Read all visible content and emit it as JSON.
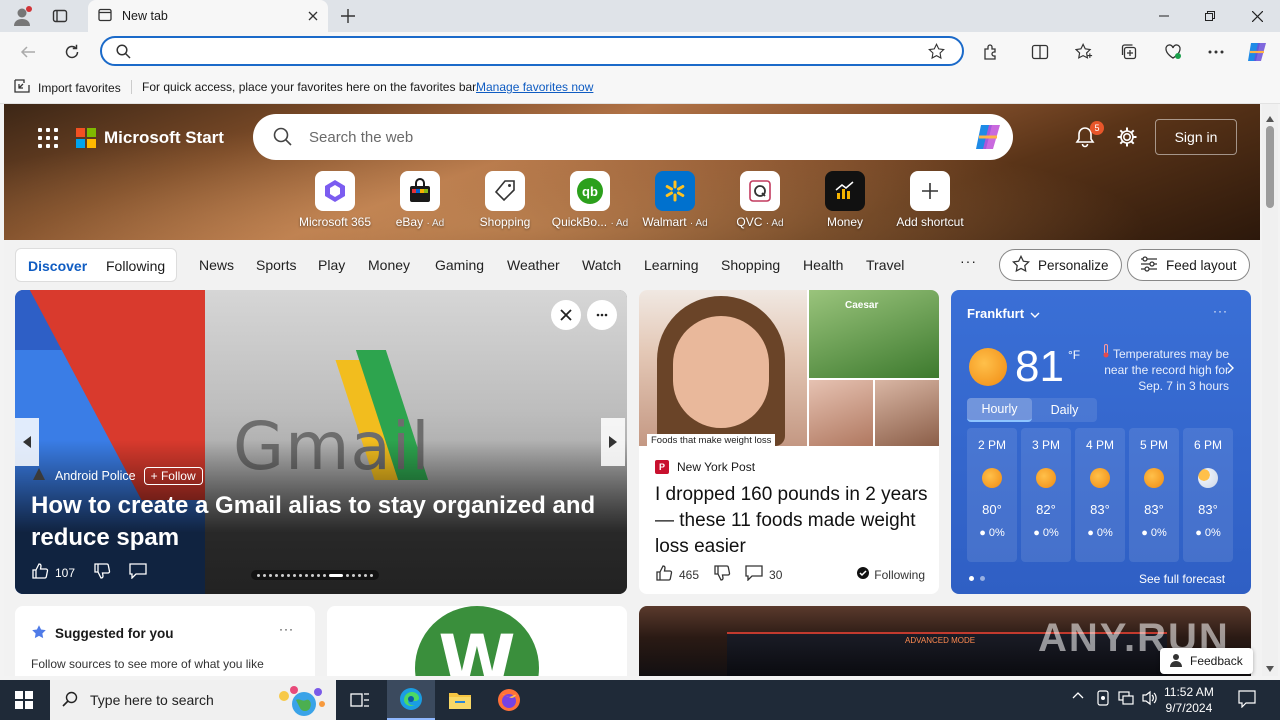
{
  "browser": {
    "tab_title": "New tab",
    "address_value": "",
    "address_placeholder": "",
    "favbar": {
      "import_label": "Import favorites",
      "quick_text": "For quick access, place your favorites here on the favorites bar.",
      "manage_link": "Manage favorites now"
    }
  },
  "start": {
    "brand": "Microsoft Start",
    "search_placeholder": "Search the web",
    "notification_count": "5",
    "signin_label": "Sign in",
    "shortcuts": [
      {
        "label": "Microsoft 365",
        "ad": ""
      },
      {
        "label": "eBay",
        "ad": "· Ad"
      },
      {
        "label": "Shopping",
        "ad": ""
      },
      {
        "label": "QuickBo...",
        "ad": "· Ad"
      },
      {
        "label": "Walmart",
        "ad": "· Ad"
      },
      {
        "label": "QVC",
        "ad": "· Ad"
      },
      {
        "label": "Money",
        "ad": ""
      },
      {
        "label": "Add shortcut",
        "ad": ""
      }
    ],
    "feed_tabs": {
      "discover": "Discover",
      "following": "Following"
    },
    "nav": [
      "News",
      "Sports",
      "Play",
      "Money",
      "Gaming",
      "Weather",
      "Watch",
      "Learning",
      "Shopping",
      "Health",
      "Travel"
    ],
    "more": "···",
    "personalize_label": "Personalize",
    "feed_layout_label": "Feed layout"
  },
  "hero_card": {
    "image_text": "Gmail",
    "source": "Android Police",
    "follow_label": "+ Follow",
    "title": "How to create a Gmail alias to stay organized and reduce spam",
    "likes": "107"
  },
  "card2": {
    "caption": "Foods that make weight loss",
    "source": "New York Post",
    "source_initial": "P",
    "image_text": "Caesar",
    "title": "I dropped 160 pounds in 2 years — these 11 foods made weight loss easier",
    "likes": "465",
    "comments": "30",
    "following_label": "Following"
  },
  "weather": {
    "city": "Frankfurt",
    "temp": "81",
    "unit": "°F",
    "alert": "Temperatures may be near the record high for Sep. 7 in 3 hours",
    "tab_hourly": "Hourly",
    "tab_daily": "Daily",
    "hours": [
      {
        "time": "2 PM",
        "temp": "80°",
        "precip": "0%",
        "icon": "sun"
      },
      {
        "time": "3 PM",
        "temp": "82°",
        "precip": "0%",
        "icon": "sun"
      },
      {
        "time": "4 PM",
        "temp": "83°",
        "precip": "0%",
        "icon": "sun"
      },
      {
        "time": "5 PM",
        "temp": "83°",
        "precip": "0%",
        "icon": "sun"
      },
      {
        "time": "6 PM",
        "temp": "83°",
        "precip": "0%",
        "icon": "partly-cloudy"
      }
    ],
    "see_full": "See full forecast"
  },
  "row2": {
    "suggested_title": "Suggested for you",
    "suggested_sub": "Follow sources to see more of what you like",
    "w_logo": "W",
    "game_banner": "ADVANCED MODE",
    "feedback": "Feedback"
  },
  "watermark": "ANY.RUN",
  "taskbar": {
    "search_placeholder": "Type here to search",
    "time": "11:52 AM",
    "date": "9/7/2024"
  },
  "colors": {
    "accent": "#0f5cc2",
    "weather_bg": "#3a6fd6",
    "taskbar": "#1f2a38"
  }
}
